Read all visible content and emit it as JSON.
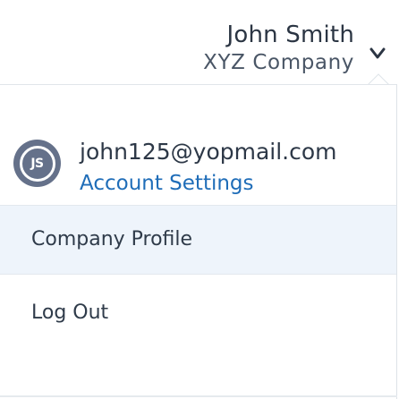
{
  "header": {
    "user_name": "John Smith",
    "company_name": "XYZ Company",
    "toggle_icon": "chevron-down-icon"
  },
  "account": {
    "avatar_initials": "JS",
    "email": "john125@yopmail.com",
    "account_settings_label": "Account Settings"
  },
  "menu": {
    "company_profile_label": "Company Profile",
    "logout_label": "Log Out"
  },
  "colors": {
    "accent_link": "#1f6db8",
    "avatar_bg": "#65718a",
    "hover_row_bg": "#eef4fb",
    "text_primary": "#2f3b4a"
  }
}
